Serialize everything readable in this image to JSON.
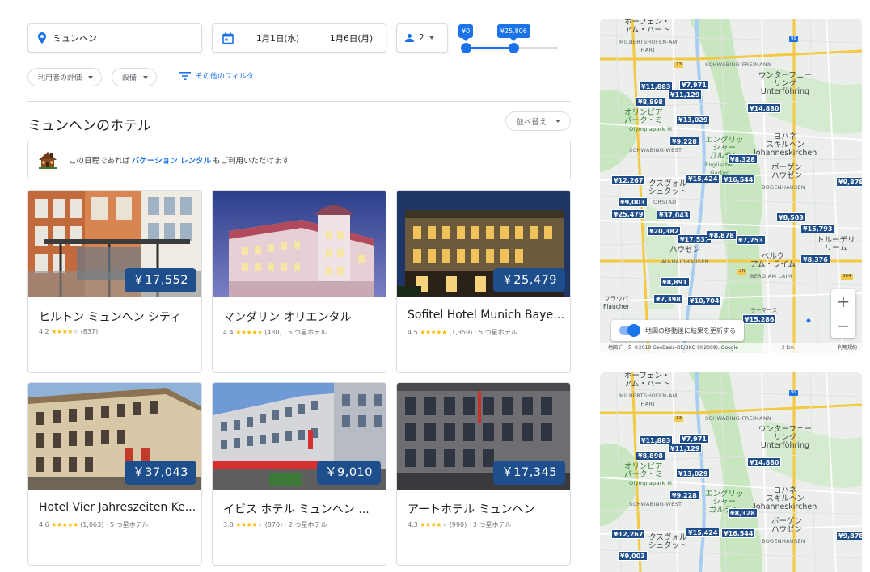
{
  "search": {
    "location": "ミュンヘン",
    "check_in": "1月1日(水)",
    "check_out": "1月6日(月)",
    "guests": "2",
    "price_min": "¥0",
    "price_max": "¥25,806",
    "price_min_fraction": 0.0,
    "price_max_fraction": 0.52
  },
  "filters": {
    "rating": "利用者の評価",
    "amenities": "設備",
    "more": "その他のフィルタ"
  },
  "section": {
    "title": "ミュンヘンのホテル",
    "sort": "並べ替え"
  },
  "banner": {
    "prefix": "この日程であれば",
    "link": "バケーション レンタル",
    "suffix": "もご利用いただけます"
  },
  "hotels": [
    {
      "name": "ヒルトン ミュンヘン シティ",
      "rating": "4.2",
      "stars": "★★★★",
      "stars_off": "★",
      "reviews": "(837)",
      "class": "",
      "price": "￥17,552"
    },
    {
      "name": "マンダリン オリエンタル",
      "rating": "4.4",
      "stars": "★★★★★",
      "stars_off": "",
      "reviews": "(430)",
      "class": "· 5 つ星ホテル",
      "price": ""
    },
    {
      "name": "Sofitel Hotel Munich Bayer...",
      "rating": "4.5",
      "stars": "★★★★★",
      "stars_off": "",
      "reviews": "(1,359)",
      "class": "· 5 つ星ホテル",
      "price": "￥25,479"
    },
    {
      "name": "Hotel Vier Jahreszeiten Ke...",
      "rating": "4.6",
      "stars": "★★★★★",
      "stars_off": "",
      "reviews": "(1,063)",
      "class": "· 5 つ星ホテル",
      "price": "￥37,043"
    },
    {
      "name": "イビス ホテル ミュンヘン ...",
      "rating": "3.8",
      "stars": "★★★★",
      "stars_off": "★",
      "reviews": "(870)",
      "class": "· 2 つ星ホテル",
      "price": "￥9,010"
    },
    {
      "name": "アートホテル ミュンヘン",
      "rating": "4.3",
      "stars": "★★★★",
      "stars_off": "★",
      "reviews": "(990)",
      "class": "· 3 つ星ホテル",
      "price": "￥17,345"
    }
  ],
  "map": {
    "pins": [
      "¥11,883",
      "¥7,971",
      "¥11,129",
      "¥8,898",
      "¥13,029",
      "¥14,880",
      "¥9,228",
      "¥8,328",
      "¥12,267",
      "¥15,424",
      "¥16,544",
      "¥9,003",
      "¥25,479",
      "¥37,043",
      "¥8,503",
      "¥15,793",
      "¥20,382",
      "¥17,537",
      "¥8,878",
      "¥7,753",
      "¥8,376",
      "¥8,891",
      "¥7,398",
      "¥10,704",
      "¥15,286",
      "¥8,878",
      "¥9,878"
    ],
    "labels": {
      "hart": "ホーフェン・\nアム・ハート",
      "hart_en": "MILBERTSHOFEN-AM\nHART",
      "unterf": "ウンターフェー\nリング\nUnterföhring",
      "olymp": "オリンピア\nパーク・ミ",
      "olymp_en": "Olympiapark M",
      "joh": "ヨハネ\nスキルヘン\nJohanneskirchen",
      "bog": "ボーゲン\nハウゼン",
      "bog_en": "BOGENHAUSEN",
      "garten": "エングリッ\nシャー\nガルテン",
      "garten_en": "Englischer\nGarten",
      "schwab": "SCHWABING-WEST",
      "schwab_f": "SCHWABING-FREIMANN",
      "hausen": "ハウゼン",
      "hausen_en": "AU-HAIDHAUSEN",
      "berg": "ベルク\nアム・ライム",
      "berg_en": "BERG AM LAIM",
      "truder": "トルーデリ\nリーム",
      "vorstadt": "クスヴォル\nシュタット",
      "vorstadt_en": "ORSTADT",
      "frau": "フラウパ\nFlaucher",
      "ramers": "ラーマース"
    },
    "road_99": "99",
    "road_13": "13",
    "road_2r": "2R",
    "road_304": "304",
    "zoom_in": "+",
    "zoom_out": "−",
    "update_on_move": "地図の移動後に結果を更新する",
    "footer_attrib": "地図データ ©2019 GeoBasis-DE/BKG (©2009), Google",
    "footer_scale": "2 km",
    "footer_terms": "利用規約"
  },
  "colors": {
    "accent": "#1a73e8",
    "price_tag": "#1e4e8c",
    "star": "#fbbc04"
  }
}
